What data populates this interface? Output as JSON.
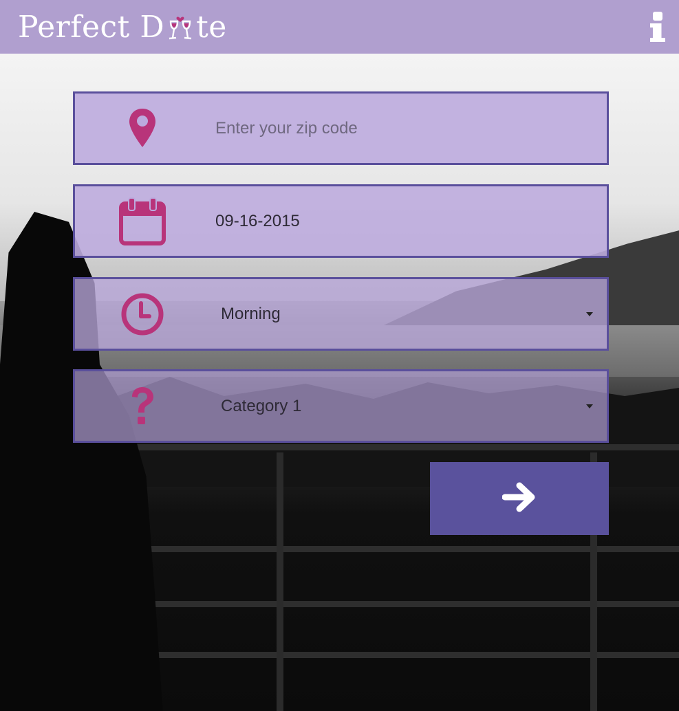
{
  "header": {
    "logo_text_start": "Perfect D",
    "logo_text_end": "te",
    "logo_icon": "wine-glasses-hearts-icon",
    "info_icon": "info-icon",
    "background_color": "#b09fcf"
  },
  "form": {
    "zip": {
      "icon": "map-pin-icon",
      "value": "",
      "placeholder": "Enter your zip code"
    },
    "date": {
      "icon": "calendar-icon",
      "value": "09-16-2015"
    },
    "time": {
      "icon": "clock-icon",
      "selected": "Morning"
    },
    "category": {
      "icon": "question-mark-icon",
      "selected": "Category 1"
    },
    "submit": {
      "icon": "arrow-right-icon"
    }
  },
  "colors": {
    "icon_accent": "#b8347a",
    "field_border": "#5a4f9c",
    "button": "#5a529d"
  }
}
